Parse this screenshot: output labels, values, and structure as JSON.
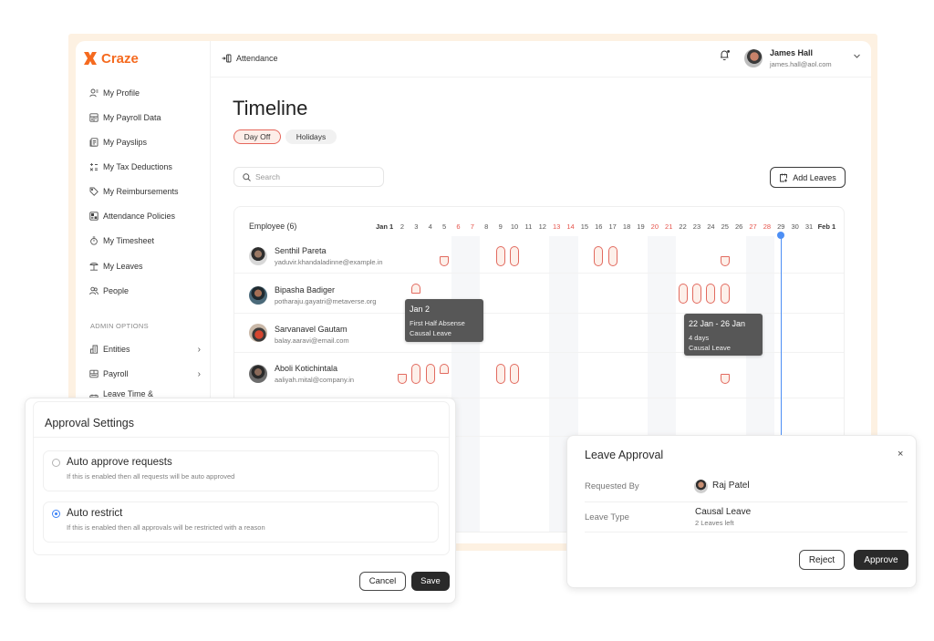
{
  "app": {
    "logo_text": "Craze"
  },
  "sidebar": {
    "items": [
      {
        "label": "My Profile",
        "icon": "user-icon"
      },
      {
        "label": "My Payroll Data",
        "icon": "payroll-data-icon"
      },
      {
        "label": "My Payslips",
        "icon": "payslip-icon"
      },
      {
        "label": "My Tax Deductions",
        "icon": "calculator-icon"
      },
      {
        "label": "My Reimbursements",
        "icon": "tag-icon"
      },
      {
        "label": "Attendance Policies",
        "icon": "policy-icon"
      },
      {
        "label": "My Timesheet",
        "icon": "stopwatch-icon"
      },
      {
        "label": "My Leaves",
        "icon": "palm-tree-icon"
      },
      {
        "label": "People",
        "icon": "people-icon"
      }
    ],
    "admin_heading": "ADMIN OPTIONS",
    "admin_items": [
      {
        "label": "Entities",
        "icon": "building-icon",
        "has_submenu": true
      },
      {
        "label": "Payroll",
        "icon": "payroll-icon",
        "has_submenu": true
      },
      {
        "label": "Leave Time & Attendance",
        "icon": "calendar-icon",
        "has_submenu": true
      }
    ]
  },
  "topbar": {
    "section": "Attendance",
    "user": {
      "name": "James Hall",
      "email": "james.hall@aol.com"
    }
  },
  "page": {
    "title": "Timeline",
    "tabs": [
      {
        "label": "Day Off",
        "active": true
      },
      {
        "label": "Holidays",
        "active": false
      }
    ],
    "search_placeholder": "Search",
    "search_value": "",
    "add_leaves_label": "Add Leaves"
  },
  "timeline": {
    "employee_header": "Employee (6)",
    "day_labels": [
      "Jan 1",
      "2",
      "3",
      "4",
      "5",
      "6",
      "7",
      "8",
      "9",
      "10",
      "11",
      "12",
      "13",
      "14",
      "15",
      "16",
      "17",
      "18",
      "19",
      "20",
      "21",
      "22",
      "23",
      "24",
      "25",
      "26",
      "27",
      "28",
      "29",
      "30",
      "31",
      "Feb 1"
    ],
    "weekend_days": [
      6,
      7,
      13,
      14,
      20,
      21,
      27,
      28
    ],
    "today_day": 29,
    "employees": [
      {
        "name": "Senthil Pareta",
        "email": "yaduvir.khandaladinne@example.in",
        "leaves": [
          {
            "day": 5,
            "portion": "second-half"
          },
          {
            "day": 9,
            "portion": "full"
          },
          {
            "day": 10,
            "portion": "full"
          },
          {
            "day": 16,
            "portion": "full"
          },
          {
            "day": 17,
            "portion": "full"
          },
          {
            "day": 25,
            "portion": "second-half"
          }
        ]
      },
      {
        "name": "Bipasha Badiger",
        "email": "potharaju.gayatri@metaverse.org",
        "leaves": [
          {
            "day": 3,
            "portion": "first-half"
          },
          {
            "day": 22,
            "portion": "full"
          },
          {
            "day": 23,
            "portion": "full"
          },
          {
            "day": 24,
            "portion": "full"
          },
          {
            "day": 25,
            "portion": "full"
          }
        ]
      },
      {
        "name": "Sarvanavel Gautam",
        "email": "balay.aaravi@email.com",
        "leaves": []
      },
      {
        "name": "Aboli Kotichintala",
        "email": "aaliyah.mital@company.in",
        "leaves": [
          {
            "day": 2,
            "portion": "second-half"
          },
          {
            "day": 3,
            "portion": "full"
          },
          {
            "day": 4,
            "portion": "full"
          },
          {
            "day": 5,
            "portion": "first-half"
          },
          {
            "day": 9,
            "portion": "full"
          },
          {
            "day": 10,
            "portion": "full"
          },
          {
            "day": 25,
            "portion": "second-half"
          }
        ]
      }
    ],
    "tooltips": [
      {
        "title": "Jan 2",
        "lines": [
          "First Half Absense",
          "Causal Leave"
        ]
      },
      {
        "title": "22 Jan - 26 Jan",
        "lines": [
          "4 days",
          "Causal Leave"
        ]
      }
    ]
  },
  "approval_settings": {
    "title": "Approval Settings",
    "options": [
      {
        "label": "Auto approve requests",
        "description": "If this is enabled then all requests will be auto approved",
        "selected": false
      },
      {
        "label": "Auto restrict",
        "description": "If this is enabled then all approvals will be restricted with a reason",
        "selected": true
      }
    ],
    "cancel_label": "Cancel",
    "save_label": "Save"
  },
  "leave_approval": {
    "title": "Leave Approval",
    "close_icon": "×",
    "requested_by_label": "Requested By",
    "requester": "Raj Patel",
    "leave_type_label": "Leave Type",
    "leave_type": "Causal Leave",
    "leaves_left": "2 Leaves left",
    "reject_label": "Reject",
    "approve_label": "Approve"
  },
  "colors": {
    "brand": "#f56a1f",
    "leave": "#e26a5f",
    "weekend_label": "#e5534b",
    "today": "#4d8ff5",
    "primary_button": "#2a2a2a"
  }
}
